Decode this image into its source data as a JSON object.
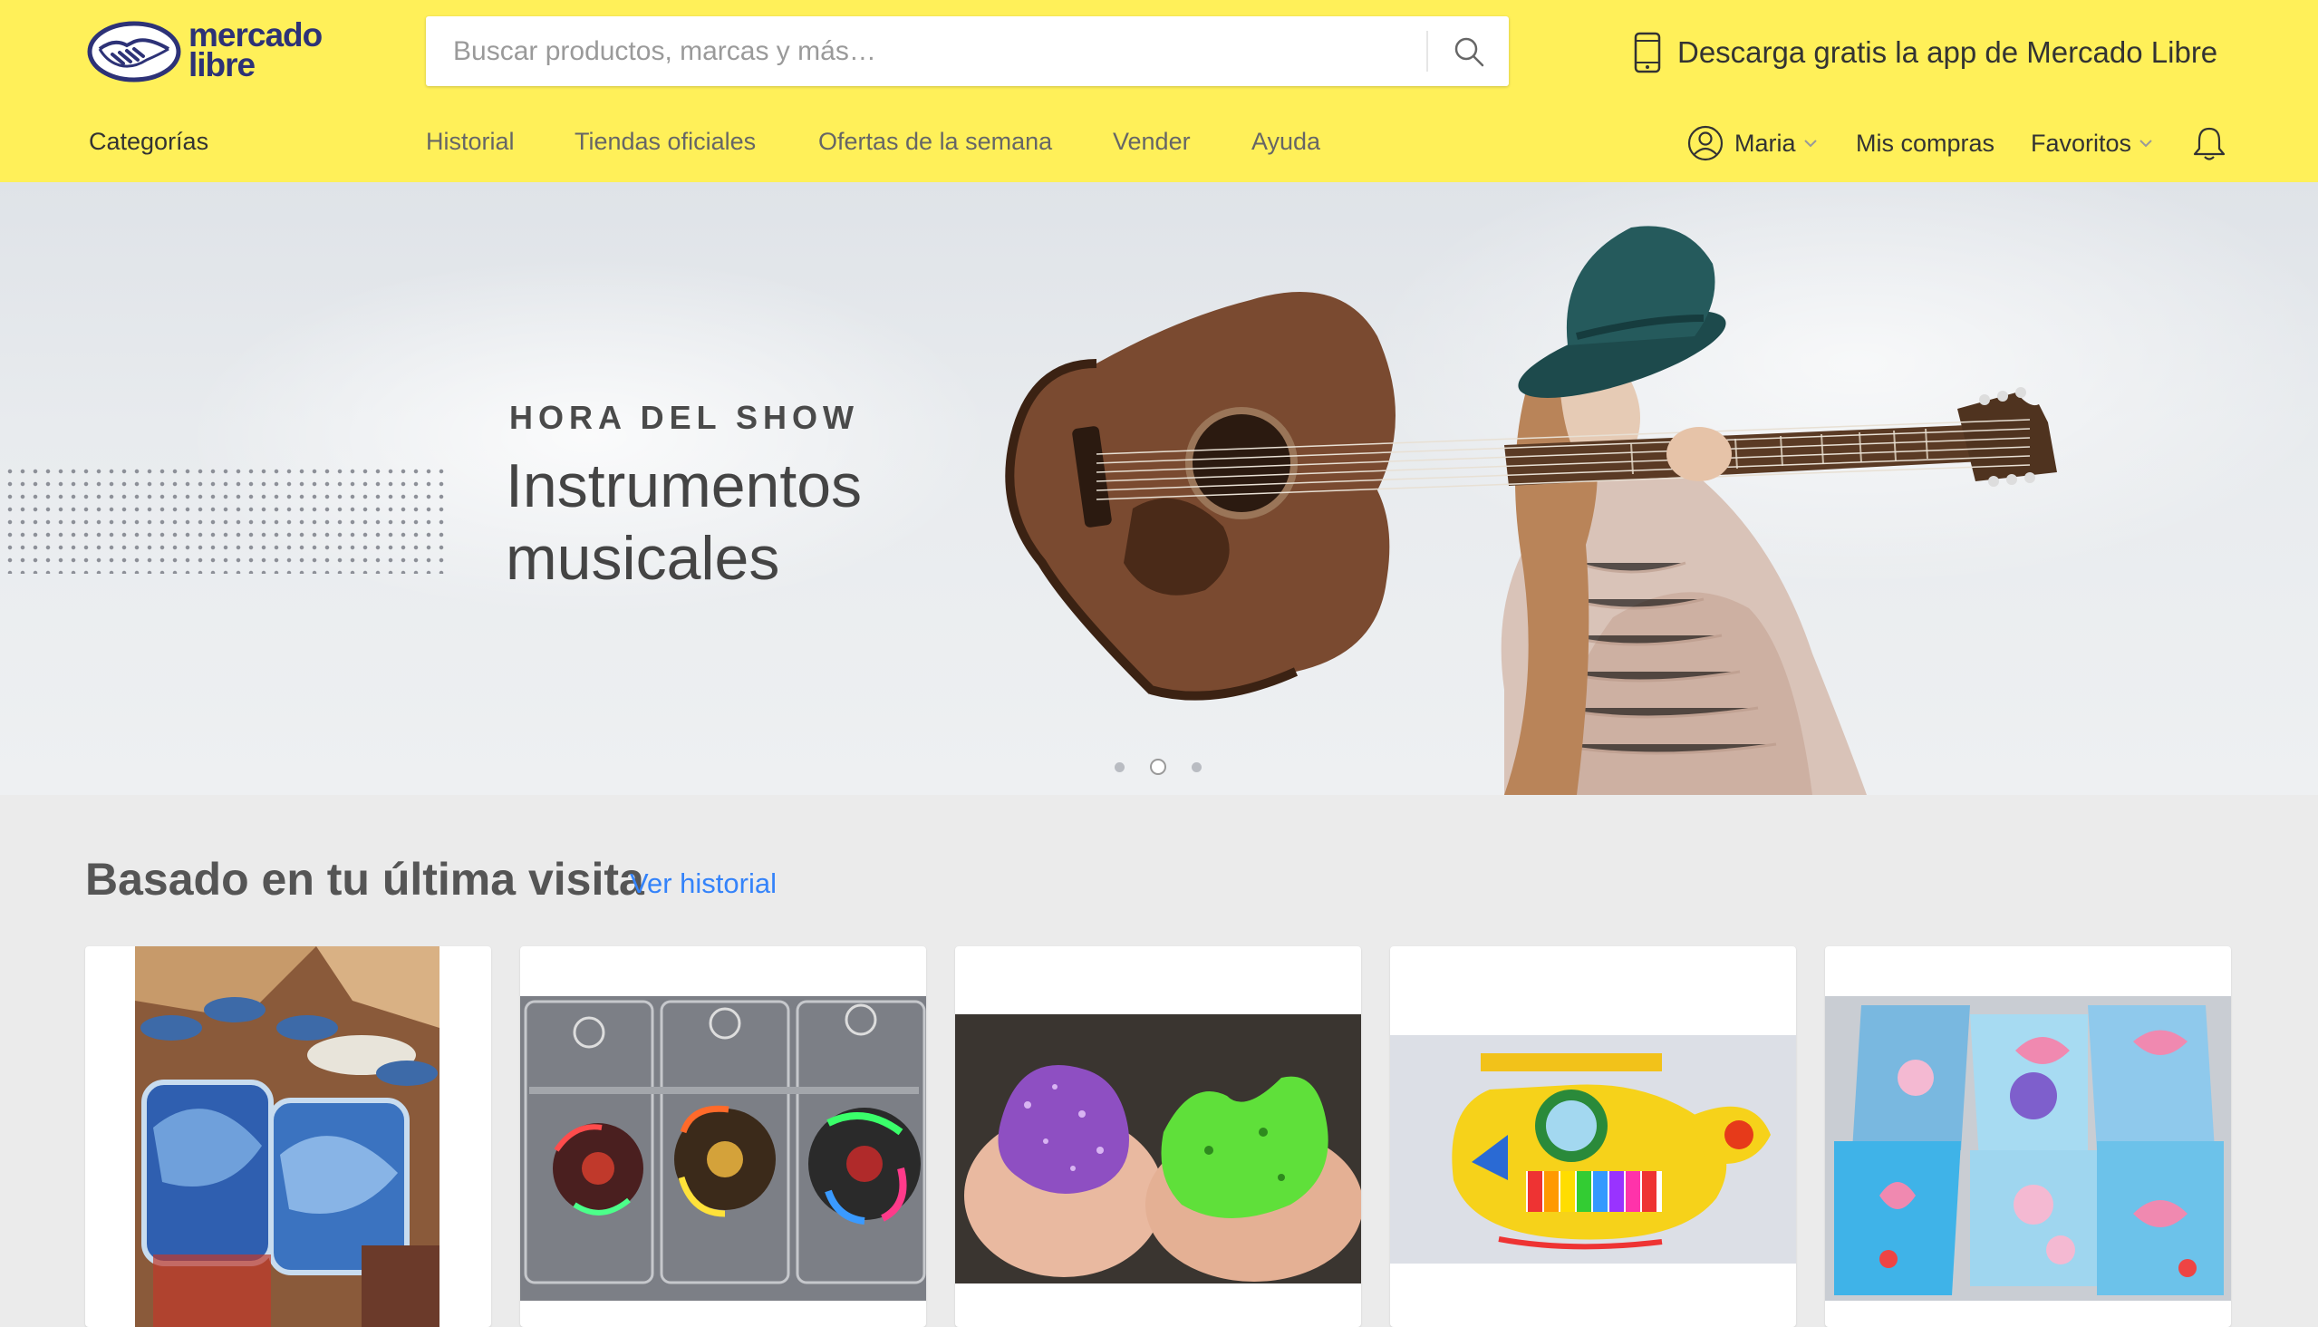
{
  "brand": {
    "logo_line1": "mercado",
    "logo_line2": "libre"
  },
  "search": {
    "placeholder": "Buscar productos, marcas y más…"
  },
  "app_promo": {
    "text": "Descarga gratis la app de Mercado Libre"
  },
  "nav": {
    "categories": "Categorías",
    "links": [
      "Historial",
      "Tiendas oficiales",
      "Ofertas de la semana",
      "Vender",
      "Ayuda"
    ]
  },
  "user": {
    "name": "Maria",
    "purchases": "Mis compras",
    "favorites": "Favoritos"
  },
  "hero": {
    "eyebrow": "HORA DEL SHOW",
    "title_line1": "Instrumentos",
    "title_line2": "musicales",
    "slides": 3,
    "active_slide": 2
  },
  "section": {
    "title": "Basado en tu última visita",
    "link": "Ver historial"
  },
  "products": [
    {
      "image": "slime-jars-photo"
    },
    {
      "image": "led-fidget-spinners-photo"
    },
    {
      "image": "glitter-slime-hands-photo"
    },
    {
      "image": "toy-helicopter-piano-photo"
    },
    {
      "image": "kids-makeup-kits-photo"
    }
  ],
  "colors": {
    "header_bg": "#fff059",
    "brand_navy": "#2d3277",
    "link_blue": "#3483fa",
    "page_bg": "#ebebeb"
  }
}
